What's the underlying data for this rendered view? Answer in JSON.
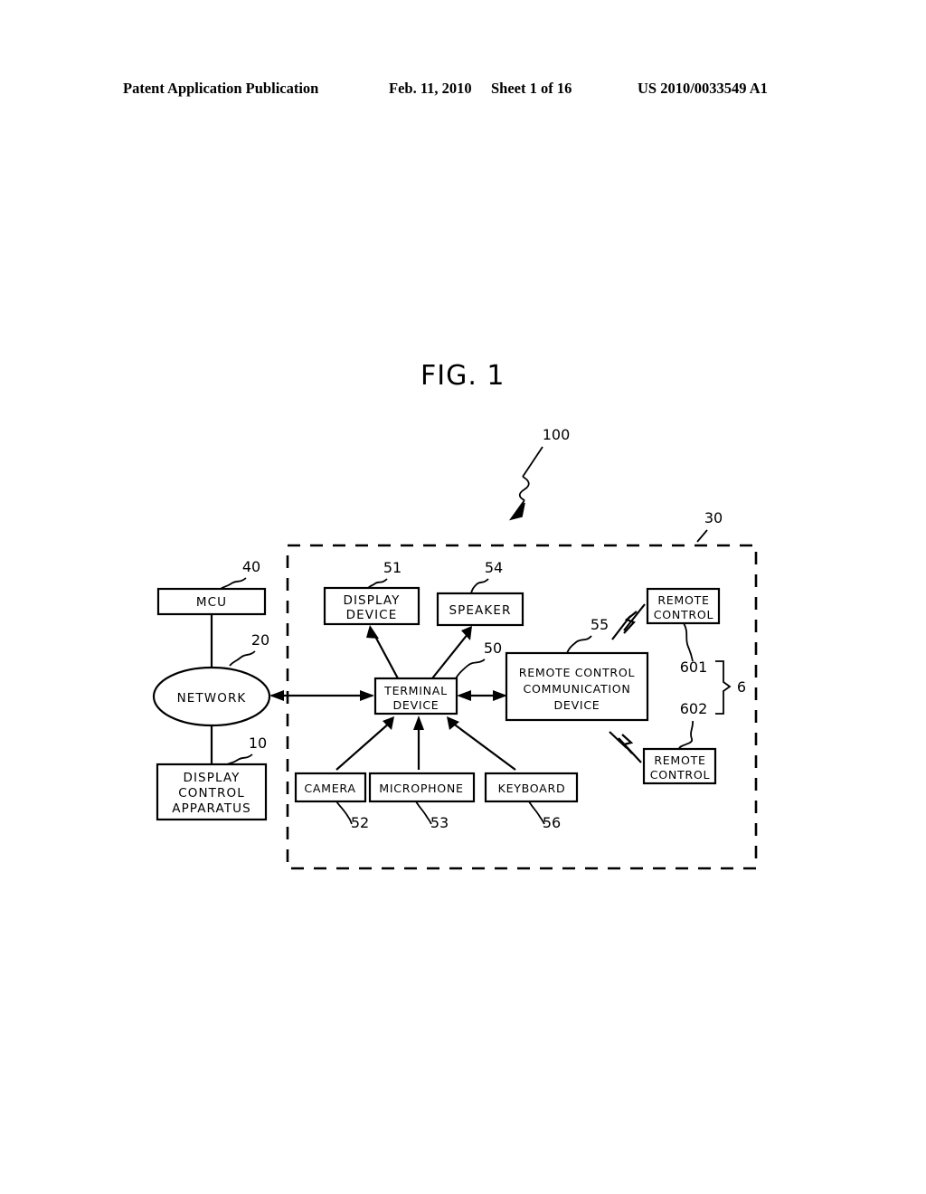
{
  "header": {
    "publication": "Patent Application Publication",
    "date": "Feb. 11, 2010",
    "sheet": "Sheet 1 of 16",
    "patent_number": "US 2010/0033549 A1"
  },
  "figure": {
    "title": "FIG. 1",
    "system_ref": "100",
    "enclosure_ref": "30"
  },
  "nodes": {
    "mcu": {
      "label": "MCU",
      "ref": "40"
    },
    "network": {
      "label": "NETWORK",
      "ref": "20"
    },
    "display_control_apparatus": {
      "line1": "DISPLAY",
      "line2": "CONTROL",
      "line3": "APPARATUS",
      "ref": "10"
    },
    "display_device": {
      "line1": "DISPLAY",
      "line2": "DEVICE",
      "ref": "51"
    },
    "speaker": {
      "label": "SPEAKER",
      "ref": "54"
    },
    "terminal_device": {
      "line1": "TERMINAL",
      "line2": "DEVICE",
      "ref": "50"
    },
    "remote_control_communication_device": {
      "line1": "REMOTE CONTROL",
      "line2": "COMMUNICATION",
      "line3": "DEVICE",
      "ref": "55"
    },
    "camera": {
      "label": "CAMERA",
      "ref": "52"
    },
    "microphone": {
      "label": "MICROPHONE",
      "ref": "53"
    },
    "keyboard": {
      "label": "KEYBOARD",
      "ref": "56"
    },
    "remote_control_upper": {
      "line1": "REMOTE",
      "line2": "CONTROL",
      "ref": "601"
    },
    "remote_control_lower": {
      "line1": "REMOTE",
      "line2": "CONTROL",
      "ref": "602"
    },
    "remote_control_group": {
      "ref": "6"
    }
  },
  "colors": {
    "ink": "#000000",
    "paper": "#ffffff"
  }
}
